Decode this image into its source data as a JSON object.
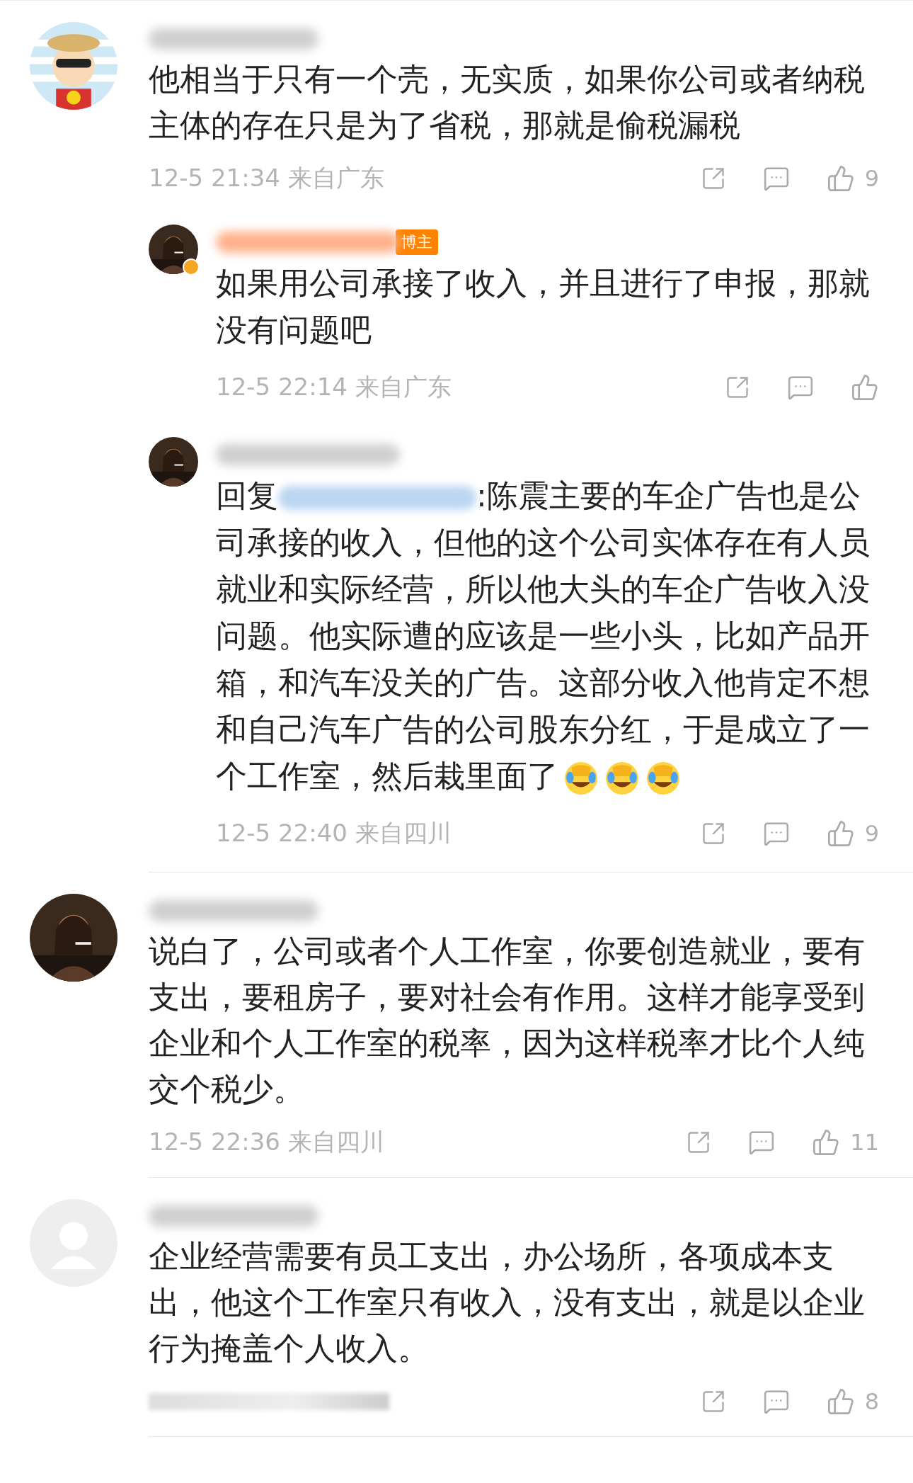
{
  "comments": [
    {
      "avatar": {
        "kind": "cartoon"
      },
      "text": "他相当于只有一个壳，无实质，如果你公司或者纳税主体的存在只是为了省税，那就是偷税漏税",
      "meta": {
        "kind": "text",
        "time": "12-5 21:34",
        "location": "来自广东"
      },
      "likes": "9",
      "replies": [
        {
          "verified": true,
          "badge": "博主",
          "text": "如果用公司承接了收入，并且进行了申报，那就没有问题吧",
          "meta": {
            "kind": "text",
            "time": "12-5 22:14",
            "location": "来自广东"
          }
        },
        {
          "reply_prefix": "回复",
          "text": ":陈震主要的车企广告也是公司承接的收入，但他的这个公司实体存在有人员就业和实际经营，所以他大头的车企广告收入没问题。他实际遭的应该是一些小头，比如产品开箱，和汽车没关的广告。这部分收入他肯定不想和自己汽车广告的公司股东分红，于是成立了一个工作室，然后栽里面了",
          "emojis": [
            {
              "kind": "laugh-cry"
            },
            {
              "kind": "laugh-cry"
            },
            {
              "kind": "laugh-cry"
            }
          ],
          "meta": {
            "kind": "text",
            "time": "12-5 22:40",
            "location": "来自四川"
          },
          "likes": "9"
        }
      ]
    },
    {
      "text": "说白了，公司或者个人工作室，你要创造就业，要有支出，要租房子，要对社会有作用。这样才能享受到企业和个人工作室的税率，因为这样税率才比个人纯交个税少。",
      "meta": {
        "kind": "text",
        "time": "12-5 22:36",
        "location": "来自四川"
      },
      "likes": "11"
    },
    {
      "avatar": {
        "kind": "default"
      },
      "text": "企业经营需要有员工支出，办公场所，各项成本支出，他这个工作室只有收入，没有支出，就是以企业行为掩盖个人收入。",
      "meta": {
        "kind": "blurred"
      },
      "likes": "8"
    }
  ]
}
